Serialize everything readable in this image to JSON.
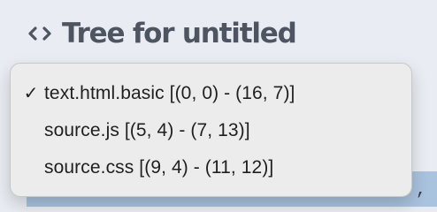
{
  "header": {
    "title": "Tree for untitled",
    "icon_name": "code-icon"
  },
  "menu": {
    "items": [
      {
        "label": "text.html.basic [(0, 0) - (16, 7)]",
        "selected": true
      },
      {
        "label": "source.js [(5, 4) - (7, 13)]",
        "selected": false
      },
      {
        "label": "source.css [(9, 4) - (11, 12)]",
        "selected": false
      }
    ]
  },
  "status": {
    "selected_text_tail": ","
  },
  "colors": {
    "header_text": "#4e5561",
    "background": "#e9ecf2",
    "menu_background": "#ececec",
    "selection_strip": "#a9c2dd"
  }
}
